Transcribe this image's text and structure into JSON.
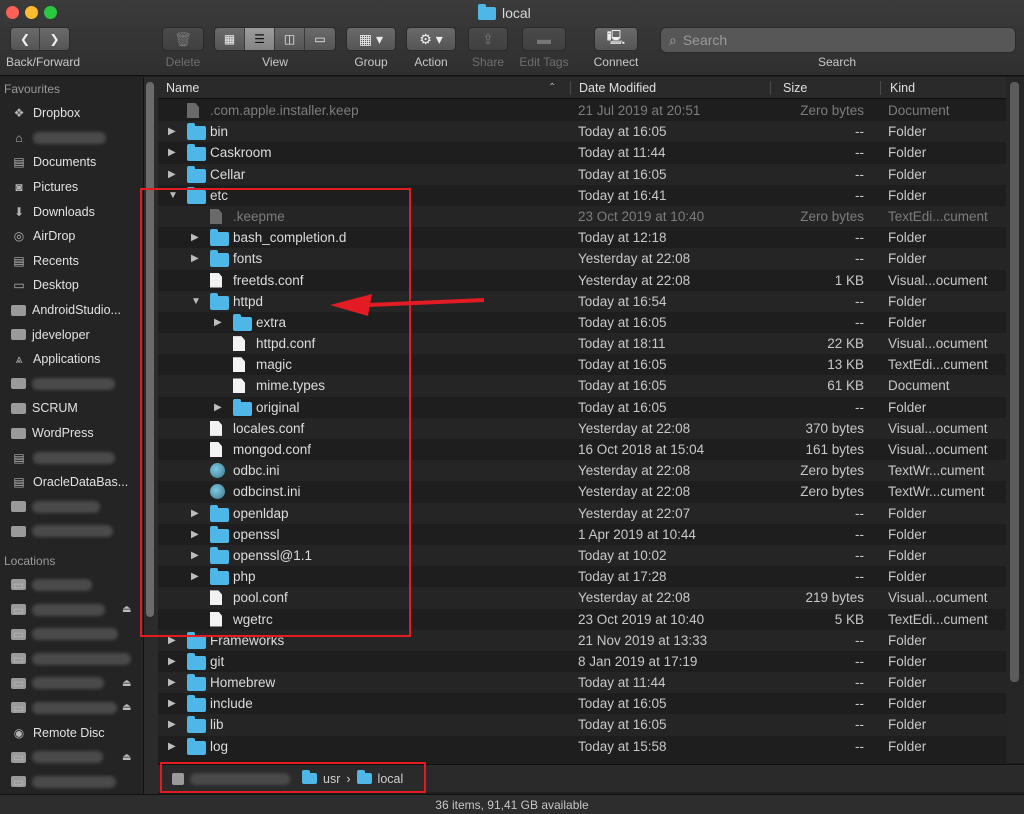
{
  "window": {
    "title": "local"
  },
  "toolbar": {
    "back_forward_label": "Back/Forward",
    "delete_label": "Delete",
    "view_label": "View",
    "group_label": "Group",
    "action_label": "Action",
    "share_label": "Share",
    "edit_tags_label": "Edit Tags",
    "connect_label": "Connect",
    "search_label": "Search",
    "search_placeholder": "Search"
  },
  "sidebar": {
    "favourites_title": "Favourites",
    "favourites": [
      {
        "label": "Dropbox",
        "icon": "dropbox-icon"
      },
      {
        "label": "",
        "icon": "home-icon",
        "redacted": true
      },
      {
        "label": "Documents",
        "icon": "document-icon"
      },
      {
        "label": "Pictures",
        "icon": "camera-icon"
      },
      {
        "label": "Downloads",
        "icon": "download-icon"
      },
      {
        "label": "AirDrop",
        "icon": "airdrop-icon"
      },
      {
        "label": "Recents",
        "icon": "recents-icon"
      },
      {
        "label": "Desktop",
        "icon": "desktop-icon"
      },
      {
        "label": "AndroidStudio...",
        "icon": "folder-icon"
      },
      {
        "label": "jdeveloper",
        "icon": "folder-icon"
      },
      {
        "label": "Applications",
        "icon": "applications-icon"
      },
      {
        "label": "",
        "icon": "folder-icon",
        "redacted": true
      },
      {
        "label": "SCRUM",
        "icon": "folder-icon"
      },
      {
        "label": "WordPress",
        "icon": "folder-icon"
      },
      {
        "label": "",
        "icon": "document-icon",
        "redacted": true
      },
      {
        "label": "OracleDataBas...",
        "icon": "document-icon"
      },
      {
        "label": "",
        "icon": "folder-icon",
        "redacted": true
      },
      {
        "label": "",
        "icon": "folder-icon",
        "redacted": true
      }
    ],
    "locations_title": "Locations",
    "locations": [
      {
        "label": "",
        "icon": "disk-icon",
        "redacted": true,
        "eject": false
      },
      {
        "label": "",
        "icon": "disk-icon",
        "redacted": true,
        "eject": true
      },
      {
        "label": "",
        "icon": "disk-icon",
        "redacted": true,
        "eject": false
      },
      {
        "label": "",
        "icon": "disk-icon",
        "redacted": true,
        "eject": false
      },
      {
        "label": "",
        "icon": "drive-icon",
        "redacted": true,
        "eject": true
      },
      {
        "label": "",
        "icon": "drive-icon",
        "redacted": true,
        "eject": true
      },
      {
        "label": "Remote Disc",
        "icon": "remote-disc-icon",
        "eject": false
      },
      {
        "label": "",
        "icon": "network-icon",
        "redacted": true,
        "eject": true
      },
      {
        "label": "",
        "icon": "network-icon",
        "redacted": true,
        "eject": false
      }
    ]
  },
  "columns": {
    "name": "Name",
    "date": "Date Modified",
    "size": "Size",
    "kind": "Kind"
  },
  "files": [
    {
      "name": ".com.apple.installer.keep",
      "date": "21 Jul 2019 at 20:51",
      "size": "Zero bytes",
      "kind": "Document",
      "depth": 0,
      "type": "doc",
      "dimmed": true
    },
    {
      "name": "bin",
      "date": "Today at 16:05",
      "size": "--",
      "kind": "Folder",
      "depth": 0,
      "type": "folder",
      "expand": "closed"
    },
    {
      "name": "Caskroom",
      "date": "Today at 11:44",
      "size": "--",
      "kind": "Folder",
      "depth": 0,
      "type": "folder",
      "expand": "closed"
    },
    {
      "name": "Cellar",
      "date": "Today at 16:05",
      "size": "--",
      "kind": "Folder",
      "depth": 0,
      "type": "folder",
      "expand": "closed"
    },
    {
      "name": "etc",
      "date": "Today at 16:41",
      "size": "--",
      "kind": "Folder",
      "depth": 0,
      "type": "folder",
      "expand": "open"
    },
    {
      "name": ".keepme",
      "date": "23 Oct 2019 at 10:40",
      "size": "Zero bytes",
      "kind": "TextEdi...cument",
      "depth": 1,
      "type": "doc",
      "dimmed": true
    },
    {
      "name": "bash_completion.d",
      "date": "Today at 12:18",
      "size": "--",
      "kind": "Folder",
      "depth": 1,
      "type": "folder",
      "expand": "closed"
    },
    {
      "name": "fonts",
      "date": "Yesterday at 22:08",
      "size": "--",
      "kind": "Folder",
      "depth": 1,
      "type": "folder",
      "expand": "closed"
    },
    {
      "name": "freetds.conf",
      "date": "Yesterday at 22:08",
      "size": "1 KB",
      "kind": "Visual...ocument",
      "depth": 1,
      "type": "doc"
    },
    {
      "name": "httpd",
      "date": "Today at 16:54",
      "size": "--",
      "kind": "Folder",
      "depth": 1,
      "type": "folder",
      "expand": "open"
    },
    {
      "name": "extra",
      "date": "Today at 16:05",
      "size": "--",
      "kind": "Folder",
      "depth": 2,
      "type": "folder",
      "expand": "closed"
    },
    {
      "name": "httpd.conf",
      "date": "Today at 18:11",
      "size": "22 KB",
      "kind": "Visual...ocument",
      "depth": 2,
      "type": "doc"
    },
    {
      "name": "magic",
      "date": "Today at 16:05",
      "size": "13 KB",
      "kind": "TextEdi...cument",
      "depth": 2,
      "type": "doc"
    },
    {
      "name": "mime.types",
      "date": "Today at 16:05",
      "size": "61 KB",
      "kind": "Document",
      "depth": 2,
      "type": "doc"
    },
    {
      "name": "original",
      "date": "Today at 16:05",
      "size": "--",
      "kind": "Folder",
      "depth": 2,
      "type": "folder",
      "expand": "closed"
    },
    {
      "name": "locales.conf",
      "date": "Yesterday at 22:08",
      "size": "370 bytes",
      "kind": "Visual...ocument",
      "depth": 1,
      "type": "doc"
    },
    {
      "name": "mongod.conf",
      "date": "16 Oct 2018 at 15:04",
      "size": "161 bytes",
      "kind": "Visual...ocument",
      "depth": 1,
      "type": "doc"
    },
    {
      "name": "odbc.ini",
      "date": "Yesterday at 22:08",
      "size": "Zero bytes",
      "kind": "TextWr...cument",
      "depth": 1,
      "type": "cfg"
    },
    {
      "name": "odbcinst.ini",
      "date": "Yesterday at 22:08",
      "size": "Zero bytes",
      "kind": "TextWr...cument",
      "depth": 1,
      "type": "cfg"
    },
    {
      "name": "openldap",
      "date": "Yesterday at 22:07",
      "size": "--",
      "kind": "Folder",
      "depth": 1,
      "type": "folder",
      "expand": "closed"
    },
    {
      "name": "openssl",
      "date": "1 Apr 2019 at 10:44",
      "size": "--",
      "kind": "Folder",
      "depth": 1,
      "type": "folder",
      "expand": "closed"
    },
    {
      "name": "openssl@1.1",
      "date": "Today at 10:02",
      "size": "--",
      "kind": "Folder",
      "depth": 1,
      "type": "folder",
      "expand": "closed"
    },
    {
      "name": "php",
      "date": "Today at 17:28",
      "size": "--",
      "kind": "Folder",
      "depth": 1,
      "type": "folder",
      "expand": "closed"
    },
    {
      "name": "pool.conf",
      "date": "Yesterday at 22:08",
      "size": "219 bytes",
      "kind": "Visual...ocument",
      "depth": 1,
      "type": "doc"
    },
    {
      "name": "wgetrc",
      "date": "23 Oct 2019 at 10:40",
      "size": "5 KB",
      "kind": "TextEdi...cument",
      "depth": 1,
      "type": "doc"
    },
    {
      "name": "Frameworks",
      "date": "21 Nov 2019 at 13:33",
      "size": "--",
      "kind": "Folder",
      "depth": 0,
      "type": "folder",
      "expand": "closed"
    },
    {
      "name": "git",
      "date": "8 Jan 2019 at 17:19",
      "size": "--",
      "kind": "Folder",
      "depth": 0,
      "type": "folder",
      "expand": "closed"
    },
    {
      "name": "Homebrew",
      "date": "Today at 11:44",
      "size": "--",
      "kind": "Folder",
      "depth": 0,
      "type": "folder",
      "expand": "closed"
    },
    {
      "name": "include",
      "date": "Today at 16:05",
      "size": "--",
      "kind": "Folder",
      "depth": 0,
      "type": "folder",
      "expand": "closed"
    },
    {
      "name": "lib",
      "date": "Today at 16:05",
      "size": "--",
      "kind": "Folder",
      "depth": 0,
      "type": "folder",
      "expand": "closed"
    },
    {
      "name": "log",
      "date": "Today at 15:58",
      "size": "--",
      "kind": "Folder",
      "depth": 0,
      "type": "folder",
      "expand": "closed"
    }
  ],
  "pathbar": {
    "segments": [
      "usr",
      "local"
    ],
    "separator": "›"
  },
  "status": {
    "text": "36 items, 91,41 GB available"
  },
  "colors": {
    "folder": "#4fb6e8",
    "annotation": "#e31b23"
  }
}
